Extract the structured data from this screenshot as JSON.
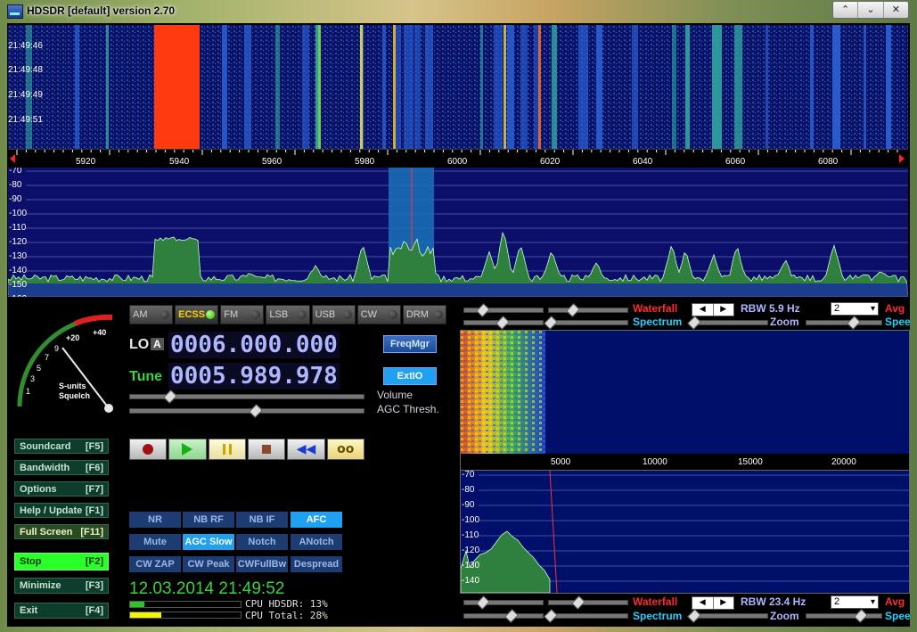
{
  "window": {
    "title": "HDSDR [default]  version 2.70",
    "buttons": [
      "⌃",
      "⌄",
      "✕"
    ]
  },
  "waterfall": {
    "timestamps": [
      "21:49:46",
      "21:49:48",
      "21:49:49",
      "21:49:51"
    ],
    "freq_ticks": [
      "5920",
      "5940",
      "5960",
      "5980",
      "6000",
      "6020",
      "6040",
      "6060",
      "6080"
    ]
  },
  "spectrum": {
    "db_ticks": [
      "-70",
      "-80",
      "-90",
      "-100",
      "-110",
      "-120",
      "-130",
      "-140",
      "-150",
      "-160"
    ]
  },
  "smeter": {
    "scale": [
      "1",
      "3",
      "5",
      "7",
      "9",
      "+20",
      "+40"
    ],
    "label1": "S-units",
    "label2": "Squelch"
  },
  "side_buttons": [
    {
      "label": "Soundcard",
      "key": "[F5]"
    },
    {
      "label": "Bandwidth",
      "key": "[F6]"
    },
    {
      "label": "Options",
      "key": "[F7]"
    },
    {
      "label": "Help / Update",
      "key": "[F1]"
    },
    {
      "label": "Full Screen",
      "key": "[F11]"
    },
    {
      "label": "Stop",
      "key": "[F2]"
    },
    {
      "label": "Minimize",
      "key": "[F3]"
    },
    {
      "label": "Exit",
      "key": "[F4]"
    }
  ],
  "modes": [
    "AM",
    "ECSS",
    "FM",
    "LSB",
    "USB",
    "CW",
    "DRM"
  ],
  "active_mode": "ECSS",
  "lo": {
    "label": "LO",
    "tag": "A",
    "value": "0006.000.000"
  },
  "tune": {
    "label": "Tune",
    "value": "0005.989.978"
  },
  "buttons": {
    "freqmgr": "FreqMgr",
    "extio": "ExtIO"
  },
  "slider_labels": {
    "volume": "Volume",
    "agc": "AGC Thresh."
  },
  "dsp": [
    [
      {
        "label": "NR",
        "on": false
      },
      {
        "label": "NB RF",
        "on": false
      },
      {
        "label": "NB IF",
        "on": false
      },
      {
        "label": "AFC",
        "on": true
      }
    ],
    [
      {
        "label": "Mute",
        "on": false
      },
      {
        "label": "AGC Slow",
        "on": true
      },
      {
        "label": "Notch",
        "on": false
      },
      {
        "label": "ANotch",
        "on": false
      }
    ],
    [
      {
        "label": "CW ZAP",
        "on": false
      },
      {
        "label": "CW Peak",
        "on": false
      },
      {
        "label": "CWFullBw",
        "on": false
      },
      {
        "label": "Despread",
        "on": false
      }
    ]
  ],
  "datetime": "12.03.2014 21:49:52",
  "cpu": {
    "hdsdr": "CPU HDSDR:  13%",
    "total": "CPU Total:  28%",
    "hdsdr_level": 0.13,
    "total_level": 0.28
  },
  "rf_controls": {
    "waterfall": "Waterfall",
    "spectrum": "Spectrum",
    "rbw": "RBW  5.9 Hz",
    "zoom": "Zoom",
    "dropdown": "2",
    "avg": "Avg",
    "speed": "Speed"
  },
  "af_scale": [
    "5000",
    "10000",
    "15000",
    "20000"
  ],
  "af_db_ticks": [
    "-70",
    "-80",
    "-90",
    "-100",
    "-110",
    "-120",
    "-130",
    "-140"
  ],
  "af_controls": {
    "waterfall": "Waterfall",
    "spectrum": "Spectrum",
    "rbw": "RBW 23.4 Hz",
    "zoom": "Zoom",
    "dropdown": "2",
    "avg": "Avg",
    "speed": "Speed"
  },
  "colors": {
    "waterfall_bg": "#0a1266",
    "spectrum_fill": "#2f7f3f",
    "accent_blue": "#1fa0f0",
    "freq_digits": "#aeb6ff",
    "red_marker": "#ff3a10"
  }
}
